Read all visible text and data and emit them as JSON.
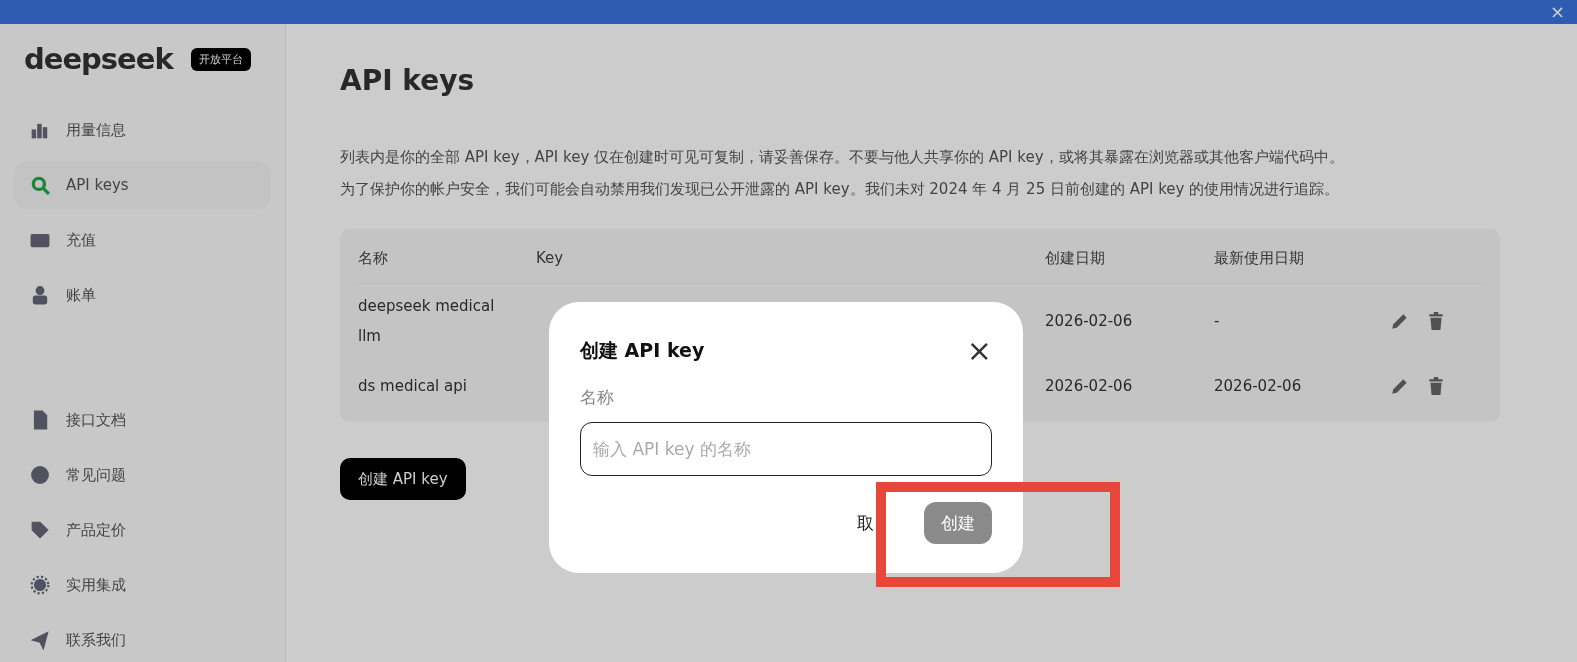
{
  "banner": {
    "close": "×"
  },
  "sidebar": {
    "logo": "deepseek",
    "badge": "开放平台",
    "items": [
      {
        "label": "用量信息",
        "selected": false
      },
      {
        "label": "API keys",
        "selected": true
      },
      {
        "label": "充值",
        "selected": false
      },
      {
        "label": "账单",
        "selected": false
      }
    ],
    "links": [
      {
        "label": "接口文档"
      },
      {
        "label": "常见问题"
      },
      {
        "label": "产品定价"
      },
      {
        "label": "实用集成"
      },
      {
        "label": "联系我们"
      }
    ]
  },
  "page": {
    "title": "API keys",
    "description": [
      "列表内是你的全部 API key，API key 仅在创建时可见可复制，请妥善保存。不要与他人共享你的 API key，或将其暴露在浏览器或其他客户端代码中。",
      "为了保护你的帐户安全，我们可能会自动禁用我们发现已公开泄露的 API key。我们未对 2024 年 4 月 25 日前创建的 API key 的使用情况进行追踪。"
    ],
    "table": {
      "columns": [
        "名称",
        "Key",
        "创建日期",
        "最新使用日期"
      ],
      "rows": [
        {
          "name": "deepseek medical llm",
          "created": "2026-02-06",
          "last_used": "-"
        },
        {
          "name": "ds medical api",
          "created": "2026-02-06",
          "last_used": "2026-02-06"
        }
      ]
    },
    "create_button": "创建 API key"
  },
  "dialog": {
    "title": "创建 API key",
    "close": "×",
    "field_label": "名称",
    "placeholder": "输入 API key 的名称",
    "cancel": "取",
    "confirm": "创建",
    "confirm_disabled": true
  },
  "annotation": {
    "kind": "highlight-frame",
    "color": "#e8463a"
  }
}
